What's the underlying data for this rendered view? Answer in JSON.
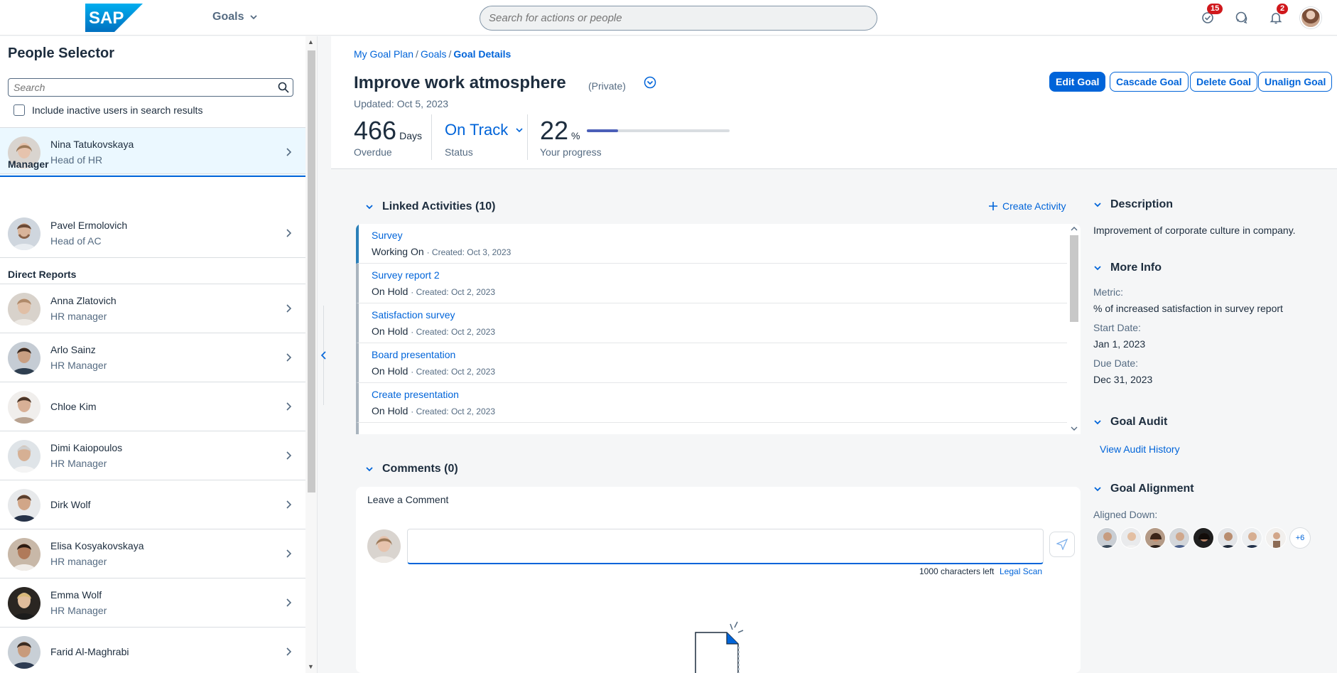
{
  "shell": {
    "app_title": "Goals",
    "search_placeholder": "Search for actions or people",
    "tasks_badge": "15",
    "notifications_badge": "2"
  },
  "people_selector": {
    "title": "People Selector",
    "search_placeholder": "Search",
    "include_inactive_label": "Include inactive users in search results",
    "selected": {
      "name": "Nina Tatukovskaya",
      "role": "Head of HR"
    },
    "manager_heading": "Manager",
    "manager": {
      "name": "Pavel Ermolovich",
      "role": "Head of AC"
    },
    "direct_reports_heading": "Direct Reports",
    "direct_reports": [
      {
        "name": "Anna Zlatovich",
        "role": "HR manager"
      },
      {
        "name": "Arlo Sainz",
        "role": "HR Manager"
      },
      {
        "name": "Chloe Kim",
        "role": ""
      },
      {
        "name": "Dimi Kaiopoulos",
        "role": "HR Manager"
      },
      {
        "name": "Dirk Wolf",
        "role": ""
      },
      {
        "name": "Elisa Kosyakovskaya",
        "role": "HR manager"
      },
      {
        "name": "Emma Wolf",
        "role": "HR Manager"
      },
      {
        "name": "Farid Al-Maghrabi",
        "role": ""
      }
    ]
  },
  "breadcrumb": {
    "item1": "My Goal Plan",
    "item2": "Goals",
    "current": "Goal Details"
  },
  "goal": {
    "title": "Improve work atmosphere",
    "visibility": "(Private)",
    "updated": "Updated: Oct 5, 2023",
    "overdue_value": "466",
    "overdue_unit": "Days",
    "overdue_label": "Overdue",
    "status_value": "On Track",
    "status_label": "Status",
    "progress_value": "22",
    "progress_unit": "%",
    "progress_label": "Your progress",
    "progress_fraction": 0.22
  },
  "actions": {
    "edit": "Edit Goal",
    "cascade": "Cascade Goal",
    "delete": "Delete Goal",
    "unalign": "Unalign Goal"
  },
  "activities": {
    "title": "Linked Activities (10)",
    "create_label": "Create Activity",
    "items": [
      {
        "title": "Survey",
        "status": "Working On",
        "created": "Created: Oct 3, 2023"
      },
      {
        "title": "Survey report 2",
        "status": "On Hold",
        "created": "Created: Oct 2, 2023"
      },
      {
        "title": "Satisfaction survey",
        "status": "On Hold",
        "created": "Created: Oct 2, 2023"
      },
      {
        "title": "Board presentation",
        "status": "On Hold",
        "created": "Created: Oct 2, 2023"
      },
      {
        "title": "Create presentation",
        "status": "On Hold",
        "created": "Created: Oct 2, 2023"
      }
    ]
  },
  "comments": {
    "title": "Comments (0)",
    "leave_label": "Leave a Comment",
    "chars_left": "1000 characters left",
    "legal_scan": "Legal Scan"
  },
  "description": {
    "title": "Description",
    "text": "Improvement of corporate culture in company."
  },
  "more_info": {
    "title": "More Info",
    "metric_label": "Metric:",
    "metric_value": "% of increased satisfaction in survey report",
    "start_label": "Start Date:",
    "start_value": "Jan 1, 2023",
    "due_label": "Due Date:",
    "due_value": "Dec 31, 2023"
  },
  "audit": {
    "title": "Goal Audit",
    "link": "View Audit History"
  },
  "alignment": {
    "title": "Goal Alignment",
    "aligned_down_label": "Aligned Down:",
    "more_count": "+6"
  },
  "colors": {
    "accent": "#0064d9",
    "selected_row": "#ebf8ff",
    "progress": "#4b5fb8"
  }
}
